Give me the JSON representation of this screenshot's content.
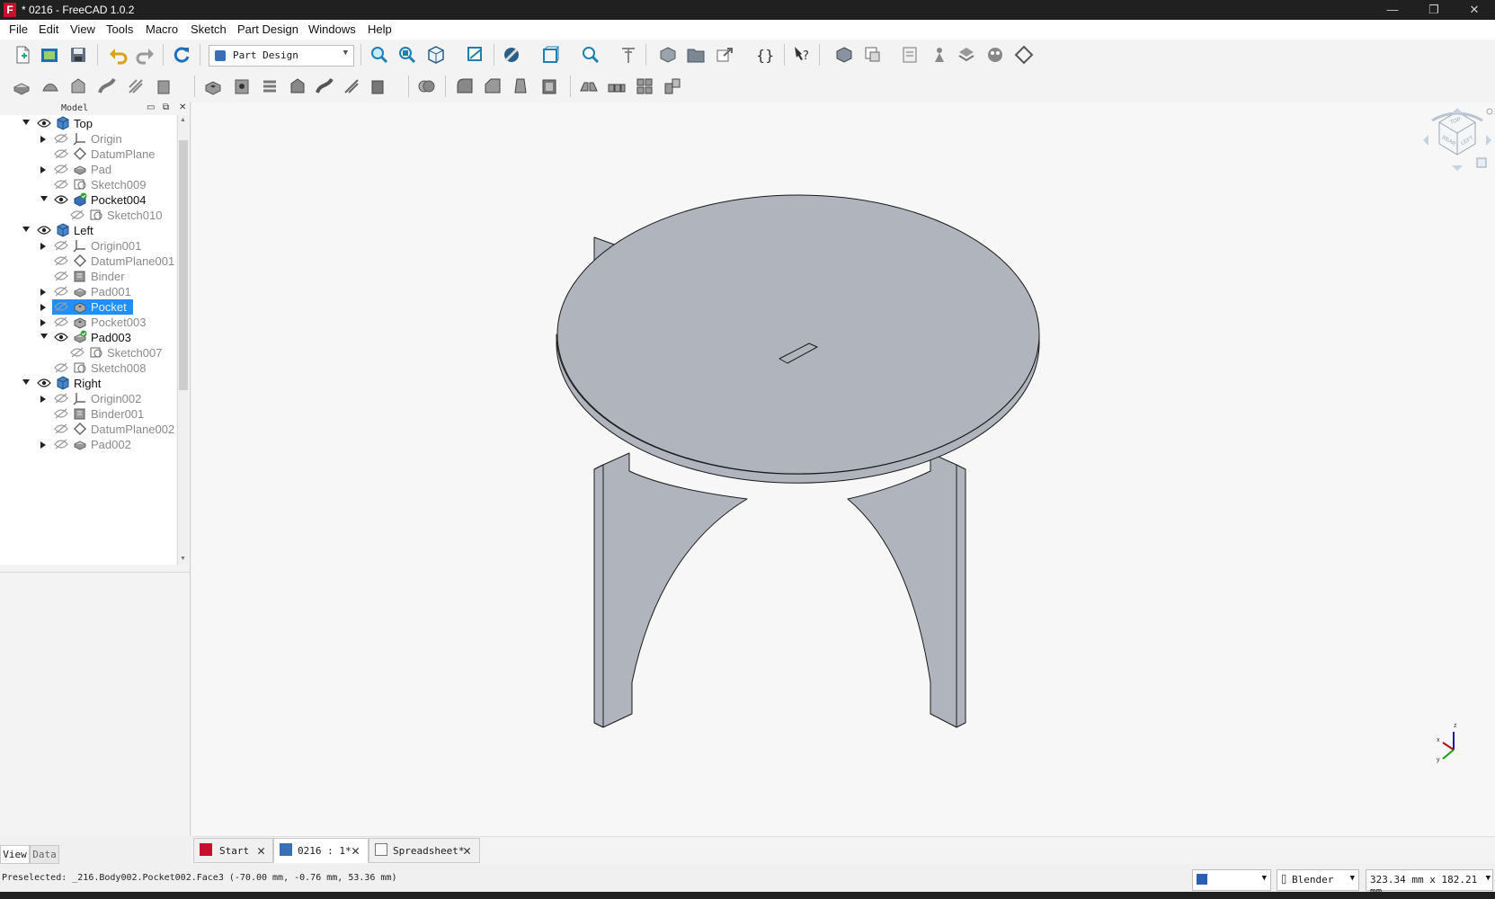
{
  "window": {
    "title": "* 0216 - FreeCAD 1.0.2",
    "app_icon": "F",
    "controls": {
      "minimize": "—",
      "restore": "❐",
      "close": "✕"
    }
  },
  "menu": [
    "File",
    "Edit",
    "View",
    "Tools",
    "Macro",
    "Sketch",
    "Part Design",
    "Windows",
    "Help"
  ],
  "workbench": {
    "selected": "Part Design"
  },
  "toolbar1_icons": [
    "new-document-icon",
    "open-document-icon",
    "save-document-icon",
    "undo-icon",
    "redo-icon",
    "refresh-icon",
    "fit-all-icon",
    "fit-selection-icon",
    "std-views-icon",
    "measure-icon",
    "draw-style-icon",
    "bounding-box-icon",
    "zoom-icon",
    "clipping-icon",
    "create-body-icon",
    "create-group-icon",
    "link-icon",
    "macro-braces-icon",
    "whats-this-icon",
    "part-icon",
    "shape-binder-icon",
    "sub-shape-binder-icon",
    "clone-icon",
    "datum-plane-icon",
    "datum-point-icon",
    "local-cs-icon"
  ],
  "toolbar2_icons": [
    "pad-icon",
    "revolve-icon",
    "additive-loft-icon",
    "additive-pipe-icon",
    "additive-helix-icon",
    "additive-primitive-icon",
    "pocket-icon",
    "hole-icon",
    "groove-icon",
    "subtractive-loft-icon",
    "subtractive-pipe-icon",
    "subtractive-helix-icon",
    "subtractive-primitive-icon",
    "boolean-icon",
    "fillet-icon",
    "chamfer-icon",
    "draft-icon",
    "thickness-icon",
    "mirrored-icon",
    "linear-pattern-icon",
    "polar-pattern-icon",
    "multi-transform-icon"
  ],
  "model_panel": {
    "title": "Model",
    "tree": [
      {
        "label": "Top",
        "level": 0,
        "arrow": "expanded",
        "icon": "body-icon",
        "visible": true
      },
      {
        "label": "Origin",
        "level": 1,
        "arrow": "collapsed",
        "icon": "origin-icon",
        "visible": false
      },
      {
        "label": "DatumPlane",
        "level": 1,
        "arrow": "none",
        "icon": "datum-plane-icon",
        "visible": false
      },
      {
        "label": "Pad",
        "level": 1,
        "arrow": "collapsed",
        "icon": "pad-icon",
        "visible": false
      },
      {
        "label": "Sketch009",
        "level": 1,
        "arrow": "none",
        "icon": "sketch-icon",
        "visible": false
      },
      {
        "label": "Pocket004",
        "level": 1,
        "arrow": "expanded",
        "icon": "pocket-tip-icon",
        "visible": true
      },
      {
        "label": "Sketch010",
        "level": 2,
        "arrow": "none",
        "icon": "sketch-icon",
        "visible": false
      },
      {
        "label": "Left",
        "level": 0,
        "arrow": "expanded",
        "icon": "body-icon",
        "visible": true
      },
      {
        "label": "Origin001",
        "level": 1,
        "arrow": "collapsed",
        "icon": "origin-icon",
        "visible": false
      },
      {
        "label": "DatumPlane001",
        "level": 1,
        "arrow": "none",
        "icon": "datum-plane-icon",
        "visible": false
      },
      {
        "label": "Binder",
        "level": 1,
        "arrow": "none",
        "icon": "binder-icon",
        "visible": false
      },
      {
        "label": "Pad001",
        "level": 1,
        "arrow": "collapsed",
        "icon": "pad-icon",
        "visible": false
      },
      {
        "label": "Pocket",
        "level": 1,
        "arrow": "collapsed",
        "icon": "pocket-icon",
        "visible": false,
        "selected": true
      },
      {
        "label": "Pocket003",
        "level": 1,
        "arrow": "collapsed",
        "icon": "pocket-icon",
        "visible": false
      },
      {
        "label": "Pad003",
        "level": 1,
        "arrow": "expanded",
        "icon": "pad-tip-icon",
        "visible": true
      },
      {
        "label": "Sketch007",
        "level": 2,
        "arrow": "none",
        "icon": "sketch-icon",
        "visible": false
      },
      {
        "label": "Sketch008",
        "level": 1,
        "arrow": "none",
        "icon": "sketch-icon",
        "visible": false
      },
      {
        "label": "Right",
        "level": 0,
        "arrow": "expanded",
        "icon": "body-icon",
        "visible": true
      },
      {
        "label": "Origin002",
        "level": 1,
        "arrow": "collapsed",
        "icon": "origin-icon",
        "visible": false
      },
      {
        "label": "Binder001",
        "level": 1,
        "arrow": "none",
        "icon": "binder-icon",
        "visible": false
      },
      {
        "label": "DatumPlane002",
        "level": 1,
        "arrow": "none",
        "icon": "datum-plane-icon",
        "visible": false
      },
      {
        "label": "Pad002",
        "level": 1,
        "arrow": "collapsed",
        "icon": "pad-icon",
        "visible": false
      }
    ],
    "tabs": [
      "View",
      "Data"
    ]
  },
  "nav_cube": {
    "faces": [
      "TOP",
      "REAR",
      "LEFT"
    ]
  },
  "axis_labels": {
    "z": "z",
    "x": "x",
    "y": "y"
  },
  "doc_tabs": [
    {
      "label": "Start",
      "active": false,
      "icon": "freecad-logo-icon"
    },
    {
      "label": "0216 : 1*",
      "active": true,
      "icon": "part-design-doc-icon"
    },
    {
      "label": "Spreadsheet*",
      "active": false,
      "icon": "spreadsheet-icon"
    }
  ],
  "status": {
    "preselection": "Preselected: _216.Body002.Pocket002.Face3 (-70.00 mm, -0.76 mm, 53.36 mm)",
    "navigation_style": "Blender",
    "dimensions": "323.34 mm x 182.21 mm"
  },
  "colors": {
    "part_face": "#b0b5bd",
    "part_edge": "#1a1a1a",
    "selection": "#1e90ff",
    "titlebar": "#202020",
    "viewport_bg": "#f7f7f7"
  }
}
